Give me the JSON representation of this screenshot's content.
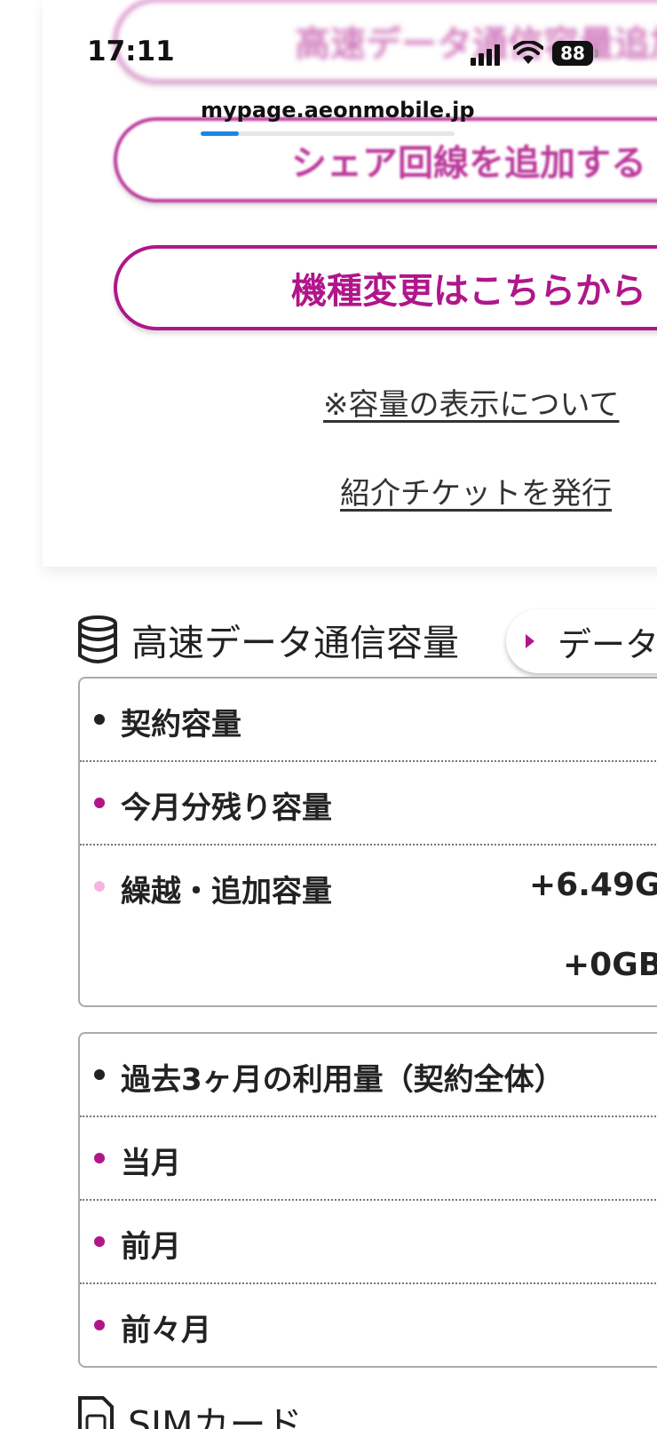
{
  "status_bar": {
    "time": "17:11",
    "battery": "88",
    "url": "mypage.aeonmobile.jp",
    "load_progress": 0.15
  },
  "buttons": {
    "ghost_top": "高速データ通信容量追加",
    "add_share": "シェア回線を追加する",
    "change_model": "機種変更はこちらから"
  },
  "links": {
    "capacity_note": "※容量の表示について",
    "referral": "紹介チケットを発行"
  },
  "data_section": {
    "title": "高速データ通信容量",
    "tab_label": "データ",
    "rows": [
      {
        "label": "契約容量",
        "dot_color": "#222222"
      },
      {
        "label": "今月分残り容量",
        "dot_color": "#b0168a"
      },
      {
        "label": "繰越・追加容量",
        "dot_color": "#f4b6de",
        "value1": "+6.49G",
        "value2": "+0GB"
      }
    ]
  },
  "usage_section": {
    "rows": [
      {
        "label": "過去3ヶ月の利用量（契約全体）",
        "dot_color": "#222222"
      },
      {
        "label": "当月",
        "dot_color": "#b0168a"
      },
      {
        "label": "前月",
        "dot_color": "#b0168a"
      },
      {
        "label": "前々月",
        "dot_color": "#b0168a"
      }
    ]
  },
  "sim_section": {
    "title": "SIMカード"
  }
}
